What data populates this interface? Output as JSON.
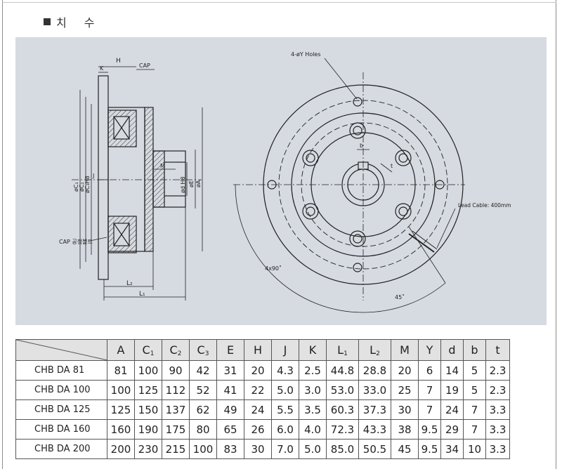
{
  "header": {
    "title": "치  수"
  },
  "drawing": {
    "labels": {
      "H": "H",
      "K": "K",
      "CAP": "CAP",
      "C1": "øC₁",
      "C2": "øC₂",
      "C3": "øC₃H8",
      "J": "J",
      "M": "M",
      "d": "ød H8",
      "E": "øE",
      "A": "øA",
      "cap_holes": "CAP 공정볼트",
      "L2": "L₂",
      "L1": "L₁",
      "holes": "4-øY Holes",
      "b": "b",
      "t": "t",
      "lead": "Lead Cable: 400mm",
      "angle90": "4x90˚",
      "angle45": "45˚"
    }
  },
  "table": {
    "columns": [
      "A",
      "C1",
      "C2",
      "C3",
      "E",
      "H",
      "J",
      "K",
      "L1",
      "L2",
      "M",
      "Y",
      "d",
      "b",
      "t"
    ],
    "column_labels": [
      {
        "main": "A",
        "sub": ""
      },
      {
        "main": "C",
        "sub": "1"
      },
      {
        "main": "C",
        "sub": "2"
      },
      {
        "main": "C",
        "sub": "3"
      },
      {
        "main": "E",
        "sub": ""
      },
      {
        "main": "H",
        "sub": ""
      },
      {
        "main": "J",
        "sub": ""
      },
      {
        "main": "K",
        "sub": ""
      },
      {
        "main": "L",
        "sub": "1"
      },
      {
        "main": "L",
        "sub": "2"
      },
      {
        "main": "M",
        "sub": ""
      },
      {
        "main": "Y",
        "sub": ""
      },
      {
        "main": "d",
        "sub": ""
      },
      {
        "main": "b",
        "sub": ""
      },
      {
        "main": "t",
        "sub": ""
      }
    ],
    "rows": [
      {
        "model": "CHB DA  81",
        "values": [
          "81",
          "100",
          "90",
          "42",
          "31",
          "20",
          "4.3",
          "2.5",
          "44.8",
          "28.8",
          "20",
          "6",
          "14",
          "5",
          "2.3"
        ]
      },
      {
        "model": "CHB DA 100",
        "values": [
          "100",
          "125",
          "112",
          "52",
          "41",
          "22",
          "5.0",
          "3.0",
          "53.0",
          "33.0",
          "25",
          "7",
          "19",
          "5",
          "2.3"
        ]
      },
      {
        "model": "CHB DA 125",
        "values": [
          "125",
          "150",
          "137",
          "62",
          "49",
          "24",
          "5.5",
          "3.5",
          "60.3",
          "37.3",
          "30",
          "7",
          "24",
          "7",
          "3.3"
        ]
      },
      {
        "model": "CHB DA 160",
        "values": [
          "160",
          "190",
          "175",
          "80",
          "65",
          "26",
          "6.0",
          "4.0",
          "72.3",
          "43.3",
          "38",
          "9.5",
          "29",
          "7",
          "3.3"
        ]
      },
      {
        "model": "CHB DA 200",
        "values": [
          "200",
          "230",
          "215",
          "100",
          "83",
          "30",
          "7.0",
          "5.0",
          "85.0",
          "50.5",
          "45",
          "9.5",
          "34",
          "10",
          "3.3"
        ]
      }
    ]
  }
}
